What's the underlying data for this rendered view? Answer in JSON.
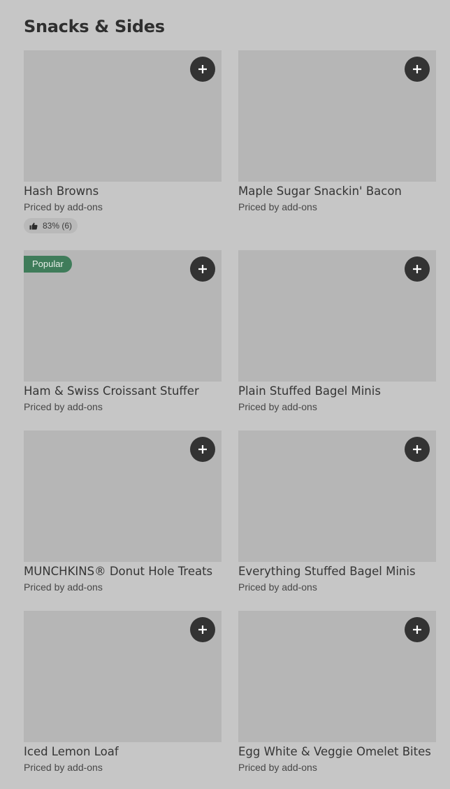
{
  "section": {
    "title": "Snacks & Sides"
  },
  "items": [
    {
      "name": "Hash Browns",
      "price": "Priced by add-ons",
      "rating": "83% (6)"
    },
    {
      "name": "Maple Sugar Snackin' Bacon",
      "price": "Priced by add-ons"
    },
    {
      "name": "Ham & Swiss Croissant Stuffer",
      "price": "Priced by add-ons",
      "badge": "Popular"
    },
    {
      "name": "Plain Stuffed Bagel Minis",
      "price": "Priced by add-ons"
    },
    {
      "name": "MUNCHKINS® Donut Hole Treats",
      "price": "Priced by add-ons"
    },
    {
      "name": "Everything Stuffed Bagel Minis",
      "price": "Priced by add-ons"
    },
    {
      "name": "Iced Lemon Loaf",
      "price": "Priced by add-ons"
    },
    {
      "name": "Egg White & Veggie Omelet Bites",
      "price": "Priced by add-ons"
    }
  ],
  "icons": {
    "add": "plus-icon",
    "rating": "thumbs-up-icon"
  },
  "colors": {
    "background": "#c6c6c6",
    "image_placeholder": "#b6b6b6",
    "add_button": "#333333",
    "popular_badge": "#3f7c5a"
  }
}
